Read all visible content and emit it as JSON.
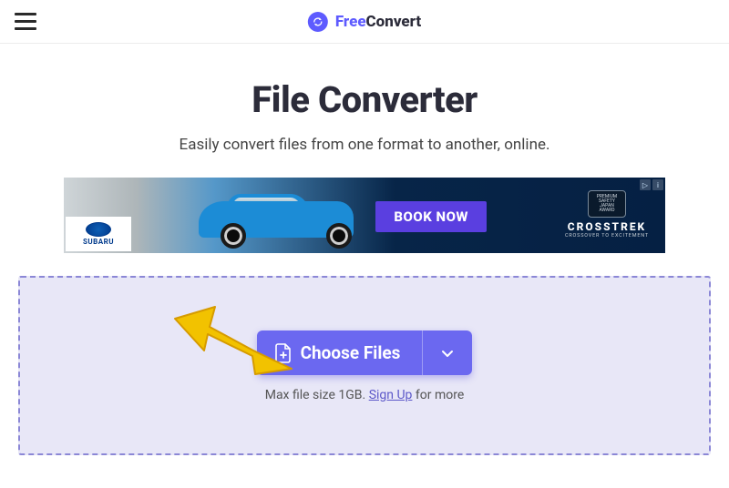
{
  "brand": {
    "free": "Free",
    "convert": "Convert"
  },
  "hero": {
    "title": "File Converter",
    "subtitle": "Easily convert files from one format to another, online."
  },
  "ad": {
    "badge_text": "SUBARU",
    "cta": "BOOK NOW",
    "brand_name": "CROSSTREK",
    "brand_tagline": "CROSSOVER TO EXCITEMENT",
    "shield_line1": "PREMIUM",
    "shield_line2": "SAFETY",
    "shield_line3": "JAPAN",
    "shield_line4": "AWARD",
    "adchoice": "▷",
    "info": "i"
  },
  "dropzone": {
    "choose_label": "Choose Files",
    "max_prefix": "Max file size 1GB. ",
    "signup": "Sign Up",
    "max_suffix": " for more"
  }
}
